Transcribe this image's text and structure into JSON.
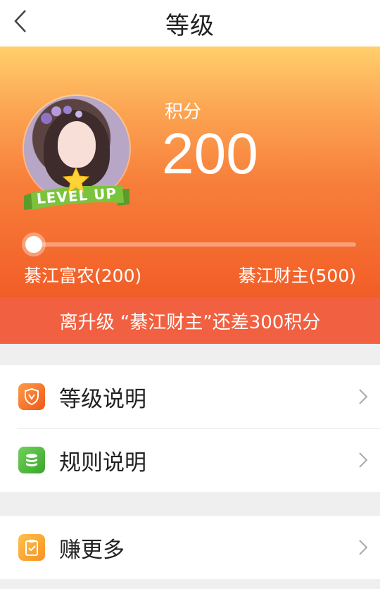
{
  "header": {
    "title": "等级"
  },
  "profile": {
    "badge_text": "LEVEL UP",
    "score_label": "积分",
    "score_value": "200",
    "progress_fraction": 0.0
  },
  "levels": {
    "current": "綦江富农(200)",
    "next": "綦江财主(500)"
  },
  "banner": {
    "text": "离升级 “綦江财主”还差300积分"
  },
  "menu": {
    "items": [
      {
        "label": "等级说明",
        "icon": "shield-icon",
        "color": "#f2731f"
      },
      {
        "label": "规则说明",
        "icon": "coins-icon",
        "color": "#49b63d"
      },
      {
        "label": "赚更多",
        "icon": "clipboard-check-icon",
        "color": "#f9a431"
      }
    ]
  }
}
